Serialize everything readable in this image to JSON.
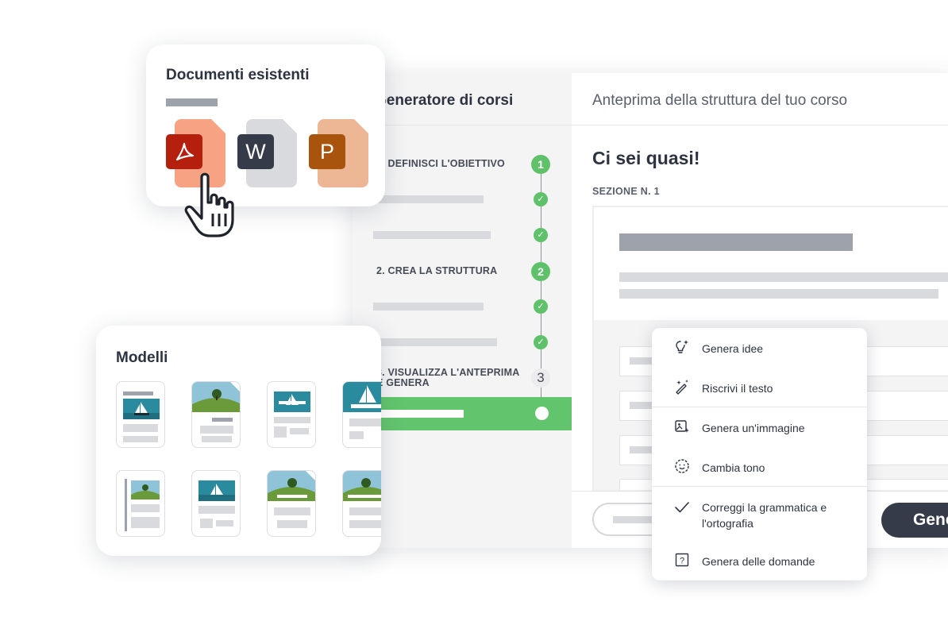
{
  "course_builder": {
    "sidebar_title": "Generatore di corsi",
    "header_preview": "Anteprima della struttura del tuo corso",
    "steps": [
      {
        "label": "1. DEFINISCI L'OBIETTIVO",
        "node": "1"
      },
      {
        "label": "2. CREA LA STRUTTURA",
        "node": "2"
      },
      {
        "label": "3. VISUALIZZA L'ANTEPRIMA E GENERA",
        "node": "3"
      }
    ],
    "check_glyph": "✓",
    "main_title": "Ci sei quasi!",
    "section_label": "SEZIONE N. 1",
    "generate_button": "Genera"
  },
  "documents_card": {
    "title": "Documenti esistenti",
    "files": [
      {
        "type": "pdf-icon",
        "glyph": "",
        "color": "#b5200e",
        "page_color": "#f6a283"
      },
      {
        "type": "word-icon",
        "glyph": "W",
        "color": "#353b48",
        "page_color": "#d9dadd"
      },
      {
        "type": "powerpoint-icon",
        "glyph": "P",
        "color": "#a8540d",
        "page_color": "#edb796"
      }
    ]
  },
  "templates_card": {
    "title": "Modelli"
  },
  "ai_menu": {
    "items": [
      {
        "icon": "lightbulb-sparkle-icon",
        "label": "Genera idee"
      },
      {
        "icon": "magic-wand-icon",
        "label": "Riscrivi il testo"
      },
      {
        "icon": "image-sparkle-icon",
        "label": "Genera un'immagine"
      },
      {
        "icon": "smiley-icon",
        "label": "Cambia tono"
      },
      {
        "icon": "checkmark-icon",
        "label": "Correggi la grammatica e l'ortografia"
      },
      {
        "icon": "question-box-icon",
        "label": "Genera delle domande"
      }
    ]
  },
  "colors": {
    "accent_green": "#62c56d",
    "dark_button": "#353b48",
    "pdf_red": "#b5200e",
    "ppt_orange": "#a8540d"
  }
}
